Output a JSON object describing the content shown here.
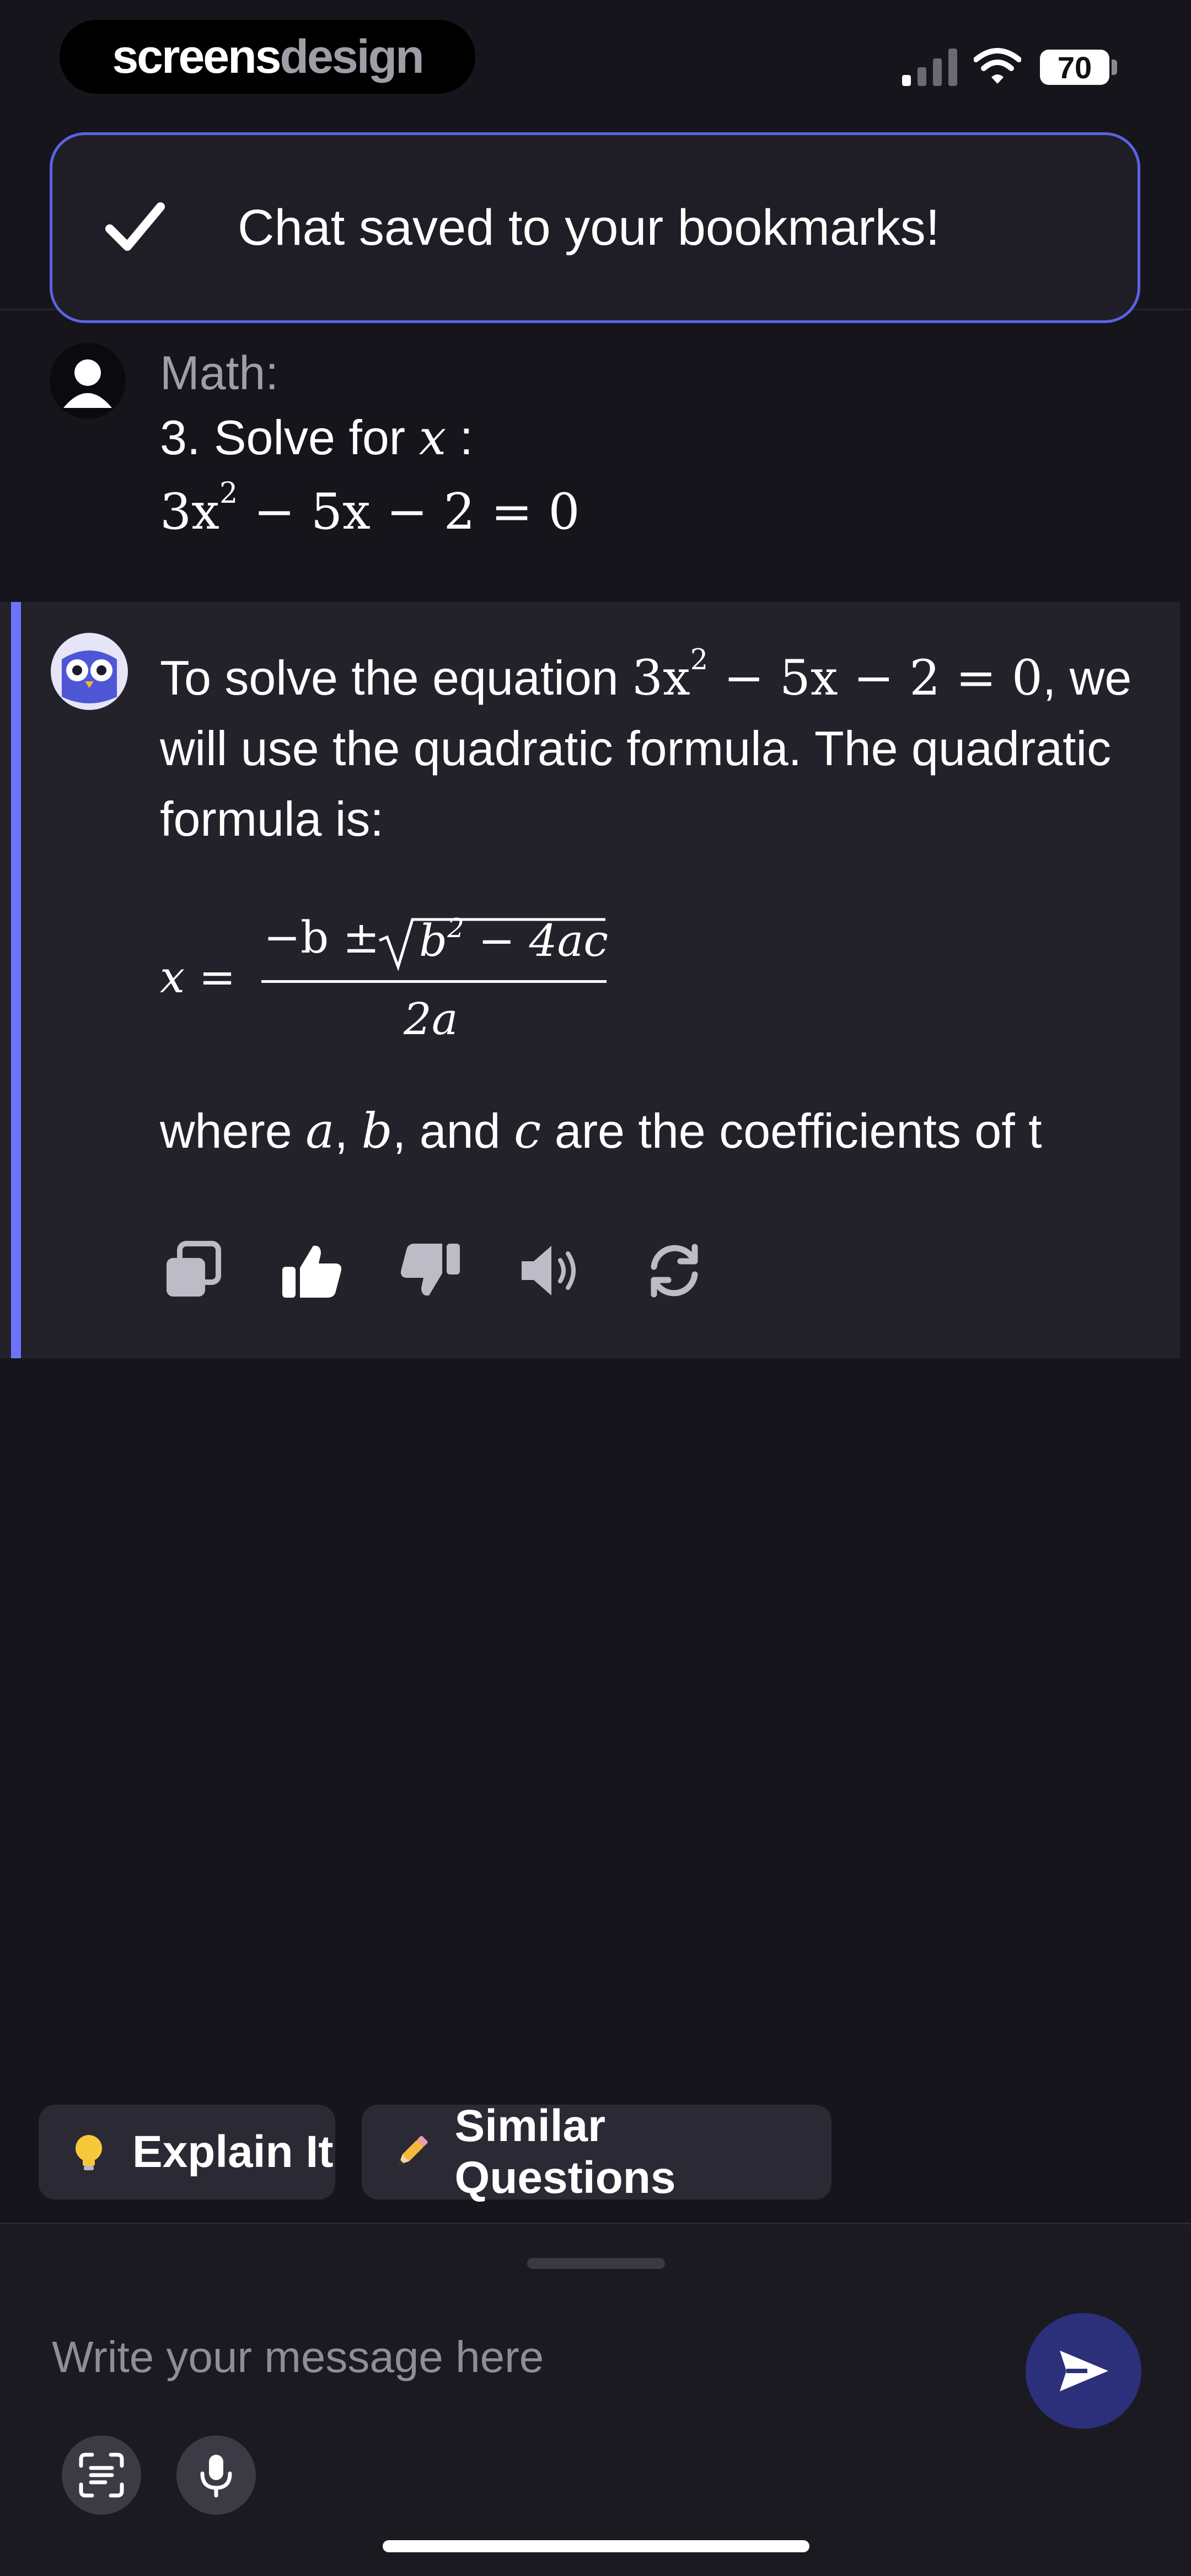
{
  "status_bar": {
    "brand_part1": "screens",
    "brand_part2": "design",
    "battery_level": "70",
    "icons": [
      "signal-icon",
      "wifi-icon",
      "battery-icon"
    ]
  },
  "toast": {
    "text": "Chat saved to your bookmarks!",
    "icon": "check-icon",
    "border_color": "#5a63e4"
  },
  "user_message": {
    "label": "Math:",
    "question_prefix": "3. Solve for",
    "question_var": "x",
    "question_suffix": " :",
    "equation": {
      "coef": "3x",
      "exp": "2",
      "rest": " − 5x − 2 = 0"
    }
  },
  "ai_message": {
    "intro_before": "To solve the equation ",
    "intro_eq_coef": "3x",
    "intro_eq_exp": "2",
    "intro_eq_rest": " − 5x − 2 = 0",
    "intro_after": ", we will use the quadratic formula. The quadratic formula is:",
    "formula": {
      "lhs": "x =",
      "numerator_pre": "−b ±",
      "radicand_b": "b",
      "radicand_exp": "2",
      "radicand_rest": " − 4ac",
      "denominator": "2a"
    },
    "tail_before_a": "where ",
    "var_a": "a",
    "sep1": ", ",
    "var_b": "b",
    "sep2": ", and ",
    "var_c": "c",
    "tail_after": " are the coefficients of t",
    "accent_color": "#6c73ff",
    "actions": [
      "copy-icon",
      "thumbs-up-icon",
      "thumbs-down-icon",
      "speaker-icon",
      "regenerate-icon"
    ]
  },
  "suggestions": {
    "explain": "Explain It",
    "similar": "Similar Questions"
  },
  "composer": {
    "placeholder": "Write your message here",
    "send_color": "#2c2f7a"
  }
}
